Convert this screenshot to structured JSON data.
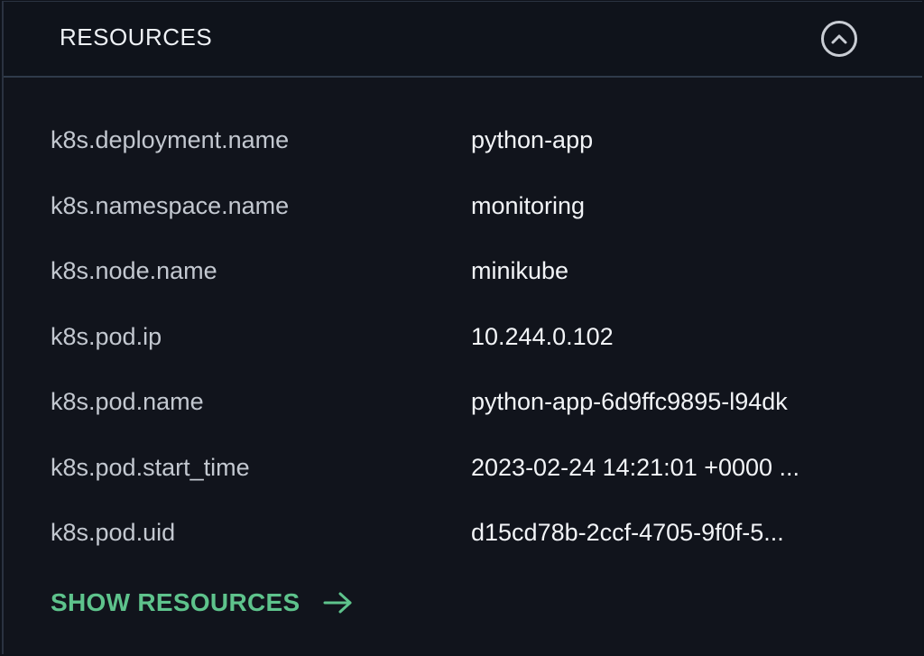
{
  "header": {
    "title": "RESOURCES",
    "collapse_icon": "chevron-up-circle-icon"
  },
  "resources": [
    {
      "key": "k8s.deployment.name",
      "value": "python-app"
    },
    {
      "key": "k8s.namespace.name",
      "value": "monitoring"
    },
    {
      "key": "k8s.node.name",
      "value": "minikube"
    },
    {
      "key": "k8s.pod.ip",
      "value": "10.244.0.102"
    },
    {
      "key": "k8s.pod.name",
      "value": "python-app-6d9ffc9895-l94dk"
    },
    {
      "key": "k8s.pod.start_time",
      "value": "2023-02-24 14:21:01 +0000 ..."
    },
    {
      "key": "k8s.pod.uid",
      "value": "d15cd78b-2ccf-4705-9f0f-5..."
    }
  ],
  "footer": {
    "show_label": "SHOW RESOURCES",
    "arrow_icon": "arrow-right-icon"
  },
  "colors": {
    "background": "#11141c",
    "accent": "#5ec38c",
    "divider": "#2f3a4a"
  }
}
